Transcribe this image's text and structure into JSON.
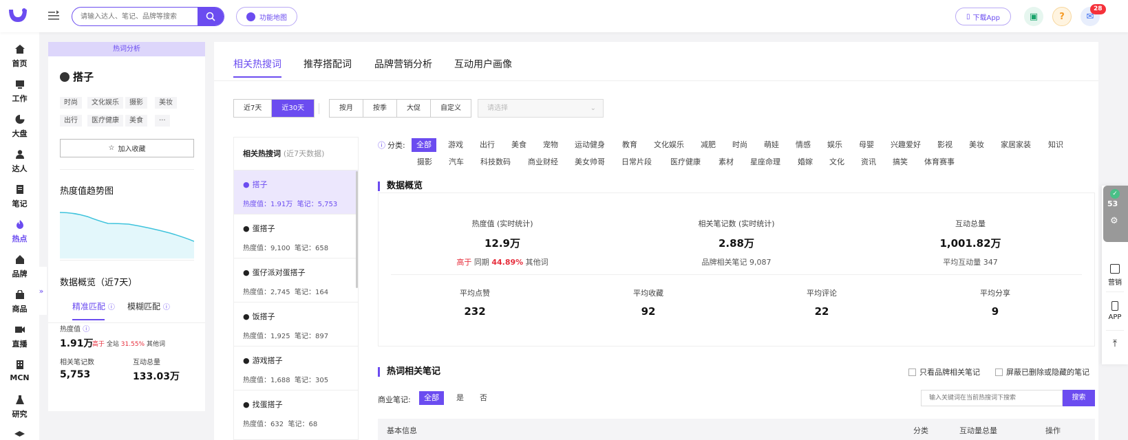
{
  "topbar": {
    "search_placeholder": "请输入达人、笔记、品牌等搜索",
    "function_map": "功能地图",
    "download_app": "下载App",
    "notification_count": "28"
  },
  "nav": [
    {
      "label": "首页",
      "icon": "home-icon"
    },
    {
      "label": "工作",
      "icon": "work-icon"
    },
    {
      "label": "大盘",
      "icon": "pie-chart-icon"
    },
    {
      "label": "达人",
      "icon": "person-icon"
    },
    {
      "label": "笔记",
      "icon": "note-icon"
    },
    {
      "label": "热点",
      "icon": "fire-icon",
      "active": true
    },
    {
      "label": "品牌",
      "icon": "brand-icon"
    },
    {
      "label": "商品",
      "icon": "bag-icon"
    },
    {
      "label": "直播",
      "icon": "video-icon"
    },
    {
      "label": "MCN",
      "icon": "building-icon"
    },
    {
      "label": "研究",
      "icon": "flask-icon"
    }
  ],
  "left_panel": {
    "header": "热词分析",
    "keyword": "搭子",
    "tags": [
      "时尚",
      "文化娱乐",
      "摄影",
      "美妆",
      "出行",
      "医疗健康",
      "美食",
      "···"
    ],
    "fav_button": "加入收藏",
    "trend_title": "热度值趋势图",
    "overview_title": "数据概览（近7天）",
    "tabs": [
      "精准匹配",
      "模糊匹配"
    ],
    "heat_label": "热度值",
    "heat_value": "1.91万",
    "heat_compare_a": "高于",
    "heat_compare_b": "全站",
    "heat_compare_pct": "31.55%",
    "heat_compare_c": "其他词",
    "notes_label": "相关笔记数",
    "notes_value": "5,753",
    "interact_label": "互动总量",
    "interact_value": "133.03万"
  },
  "main": {
    "tabs": [
      "相关热搜词",
      "推荐搭配词",
      "品牌营销分析",
      "互动用户画像"
    ],
    "range": [
      "近7天",
      "近30天"
    ],
    "period": [
      "按月",
      "按季",
      "大促",
      "自定义"
    ],
    "select_placeholder": "请选择",
    "kw_list_title": "相关热搜词",
    "kw_list_sub": "(近7天数据)",
    "keywords": [
      {
        "name": "搭子",
        "heat": "热度值：1.91万",
        "notes": "笔记：5,753"
      },
      {
        "name": "蛋搭子",
        "heat": "热度值：9,100",
        "notes": "笔记：658"
      },
      {
        "name": "蛋仔派对蛋搭子",
        "heat": "热度值：2,745",
        "notes": "笔记：164"
      },
      {
        "name": "饭搭子",
        "heat": "热度值：1,925",
        "notes": "笔记：897"
      },
      {
        "name": "游戏搭子",
        "heat": "热度值：1,688",
        "notes": "笔记：305"
      },
      {
        "name": "找蛋搭子",
        "heat": "热度值：632",
        "notes": "笔记：68"
      }
    ],
    "category_label": "分类:",
    "categories_row1": [
      "全部",
      "游戏",
      "出行",
      "美食",
      "宠物",
      "运动健身",
      "教育",
      "文化娱乐",
      "减肥",
      "时尚",
      "萌娃",
      "情感",
      "娱乐",
      "母婴",
      "兴趣爱好",
      "影视",
      "美妆",
      "家居家装",
      "知识"
    ],
    "categories_row2": [
      "摄影",
      "汽车",
      "科技数码",
      "商业财经",
      "美女帅哥",
      "日常片段",
      "医疗健康",
      "素材",
      "星座命理",
      "婚嫁",
      "文化",
      "资讯",
      "搞笑",
      "体育赛事"
    ],
    "overview_title": "数据概览",
    "overview": {
      "heat_label": "热度值 (实时统计)",
      "heat_value": "12.9万",
      "heat_sub_a": "高于",
      "heat_sub_b": "同期",
      "heat_sub_pct": "44.89%",
      "heat_sub_c": "其他词",
      "notes_label": "相关笔记数 (实时统计)",
      "notes_value": "2.88万",
      "notes_sub": "品牌相关笔记 9,087",
      "interact_label": "互动总量",
      "interact_value": "1,001.82万",
      "interact_sub": "平均互动量 347",
      "likes_label": "平均点赞",
      "likes_value": "232",
      "collect_label": "平均收藏",
      "collect_value": "92",
      "comment_label": "平均评论",
      "comment_value": "22",
      "share_label": "平均分享",
      "share_value": "9"
    },
    "notes_title": "热词相关笔记",
    "check_brand": "只看品牌相关笔记",
    "check_hide": "屏蔽已删除或隐藏的笔记",
    "biz_label": "商业笔记:",
    "biz_options": [
      "全部",
      "是",
      "否"
    ],
    "search_placeholder": "输入关键词在当前热搜词下搜索",
    "search_btn": "搜索",
    "table_headers": [
      "基本信息",
      "分类",
      "互动量总量",
      "操作"
    ]
  },
  "rightbar": {
    "marketing": "营销",
    "app": "APP",
    "widget_value": "53"
  },
  "colors": {
    "accent": "#6b4cf0",
    "red": "#e62e3c"
  }
}
